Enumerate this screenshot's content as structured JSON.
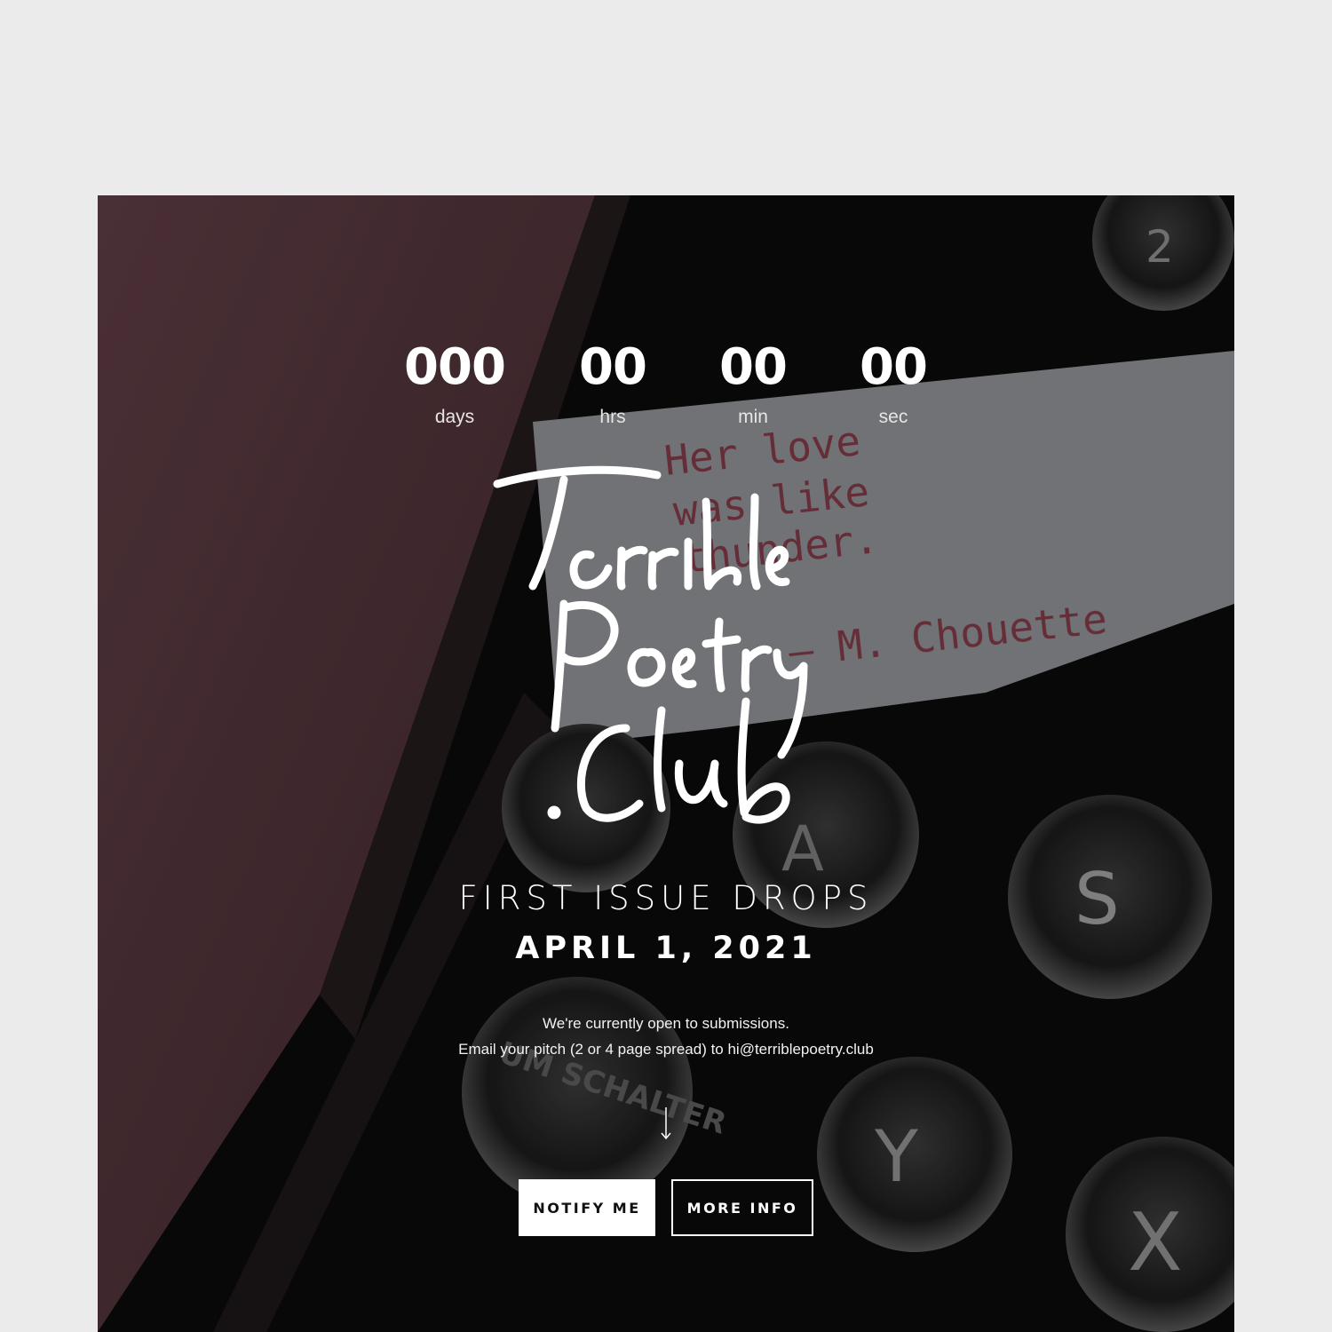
{
  "countdown": {
    "days": {
      "value": "000",
      "label": "days"
    },
    "hours": {
      "value": "00",
      "label": "hrs"
    },
    "minutes": {
      "value": "00",
      "label": "min"
    },
    "seconds": {
      "value": "00",
      "label": "sec"
    }
  },
  "logo": {
    "text": "Terrible Poetry .Club"
  },
  "background_paper": {
    "lines": [
      "Her love",
      "was like",
      "thunder.",
      "— M. Chouette"
    ]
  },
  "background_keys": [
    "2",
    "A",
    "S",
    "Y",
    "X",
    "UM SCHALTER"
  ],
  "hero": {
    "tagline": "FIRST ISSUE DROPS",
    "date": "APRIL 1, 2021",
    "info_line1": "We're currently open to submissions.",
    "info_line2": "Email your pitch (2 or 4 page spread) to hi@terriblepoetry.club"
  },
  "buttons": {
    "notify": "NOTIFY ME",
    "more_info": "MORE INFO"
  },
  "colors": {
    "page_background": "#ebebeb",
    "accent_pink": "#5a3a40",
    "paper_ink": "#8a2a3a"
  }
}
